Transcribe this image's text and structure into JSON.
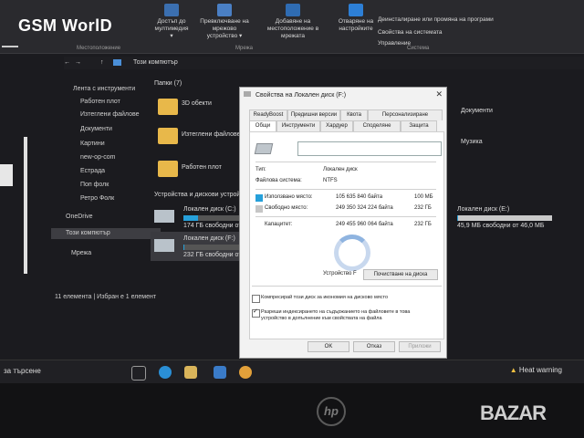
{
  "logo": "GSM WorlD",
  "ribbon": {
    "items": [
      {
        "label": "Достъп до\nмултимедия ▾"
      },
      {
        "label": "Превключване на мрежово\nустройство ▾"
      },
      {
        "label": "Добавяне на\nместоположение в мрежата"
      },
      {
        "label": "Отваряне на\nнастройките"
      }
    ],
    "right_links": [
      "Деинсталиране или промяна на програми",
      "Свойства на системата",
      "Управление"
    ],
    "groups": [
      "Местоположение",
      "Мрежа",
      "Система"
    ]
  },
  "address": {
    "path": "Този компютър"
  },
  "nav": {
    "items": [
      {
        "label": "Лента с инструменти"
      },
      {
        "label": "Работен плот"
      },
      {
        "label": "Изтеглени файлове"
      },
      {
        "label": "Документи"
      },
      {
        "label": "Картини"
      },
      {
        "label": "new-op-com"
      },
      {
        "label": "Естрада"
      },
      {
        "label": "Поп фолк"
      },
      {
        "label": "Ретро Фолк"
      },
      {
        "label": "OneDrive"
      },
      {
        "label": "Този компютър"
      },
      {
        "label": "Мрежа"
      }
    ]
  },
  "content": {
    "folders_header": "Папки (7)",
    "folders": [
      {
        "label": "3D обекти"
      },
      {
        "label": "Изтеглени файлове"
      },
      {
        "label": "Работен плот"
      }
    ],
    "right_folders": [
      {
        "label": "Документи"
      },
      {
        "label": "Музика"
      }
    ],
    "drives_header": "Устройства и дискови устройства",
    "drives": [
      {
        "label": "Локален диск (C:)",
        "free": "174 ГБ свободни от",
        "used_fraction": 0.25
      },
      {
        "label": "Локален диск (F:)",
        "free": "232 ГБ свободни от",
        "used_fraction": 0.01
      }
    ],
    "right_drive": {
      "label": "Локален диск (E:)",
      "free": "45,9 МБ свободни от 46,0 МБ",
      "used_fraction": 0.01
    }
  },
  "status": {
    "items": "11 елемента",
    "selected": "Избран е 1 елемент"
  },
  "taskbar": {
    "search_placeholder": "за търсене",
    "weather": "Heat warning"
  },
  "dialog": {
    "title": "Свойства на Локален диск (F:)",
    "tabs_row1": [
      "ReadyBoost",
      "Предишни версии",
      "Квота",
      "Персонализиране"
    ],
    "tabs_row2": [
      "Общи",
      "Инструменти",
      "Хардуер",
      "Споделяне",
      "Защита"
    ],
    "active_tab": "Общи",
    "name_value": "",
    "type_label": "Тип:",
    "type_value": "Локален диск",
    "fs_label": "Файлова система:",
    "fs_value": "NTFS",
    "used_label": "Използвано място:",
    "used_bytes": "105 635 840 байта",
    "used_short": "100 МБ",
    "free_label": "Свободно място:",
    "free_bytes": "249 350 324 224 байта",
    "free_short": "232 ГБ",
    "capacity_label": "Капацитет:",
    "capacity_bytes": "249 455 960 064 байта",
    "capacity_short": "232 ГБ",
    "device_label": "Устройство F",
    "cleanup_button": "Почистване на диска",
    "compress_label": "Компресирай този диск за икономия на дисково място",
    "index_label": "Разреши индексирането на съдържанието на файловете в това устройство в допълнение към свойствата на файла",
    "ok": "OK",
    "cancel": "Отказ",
    "apply": "Приложи",
    "colors": {
      "used": "#26a0da",
      "free": "#c6c6c6"
    }
  },
  "watermark": "BAZAR"
}
